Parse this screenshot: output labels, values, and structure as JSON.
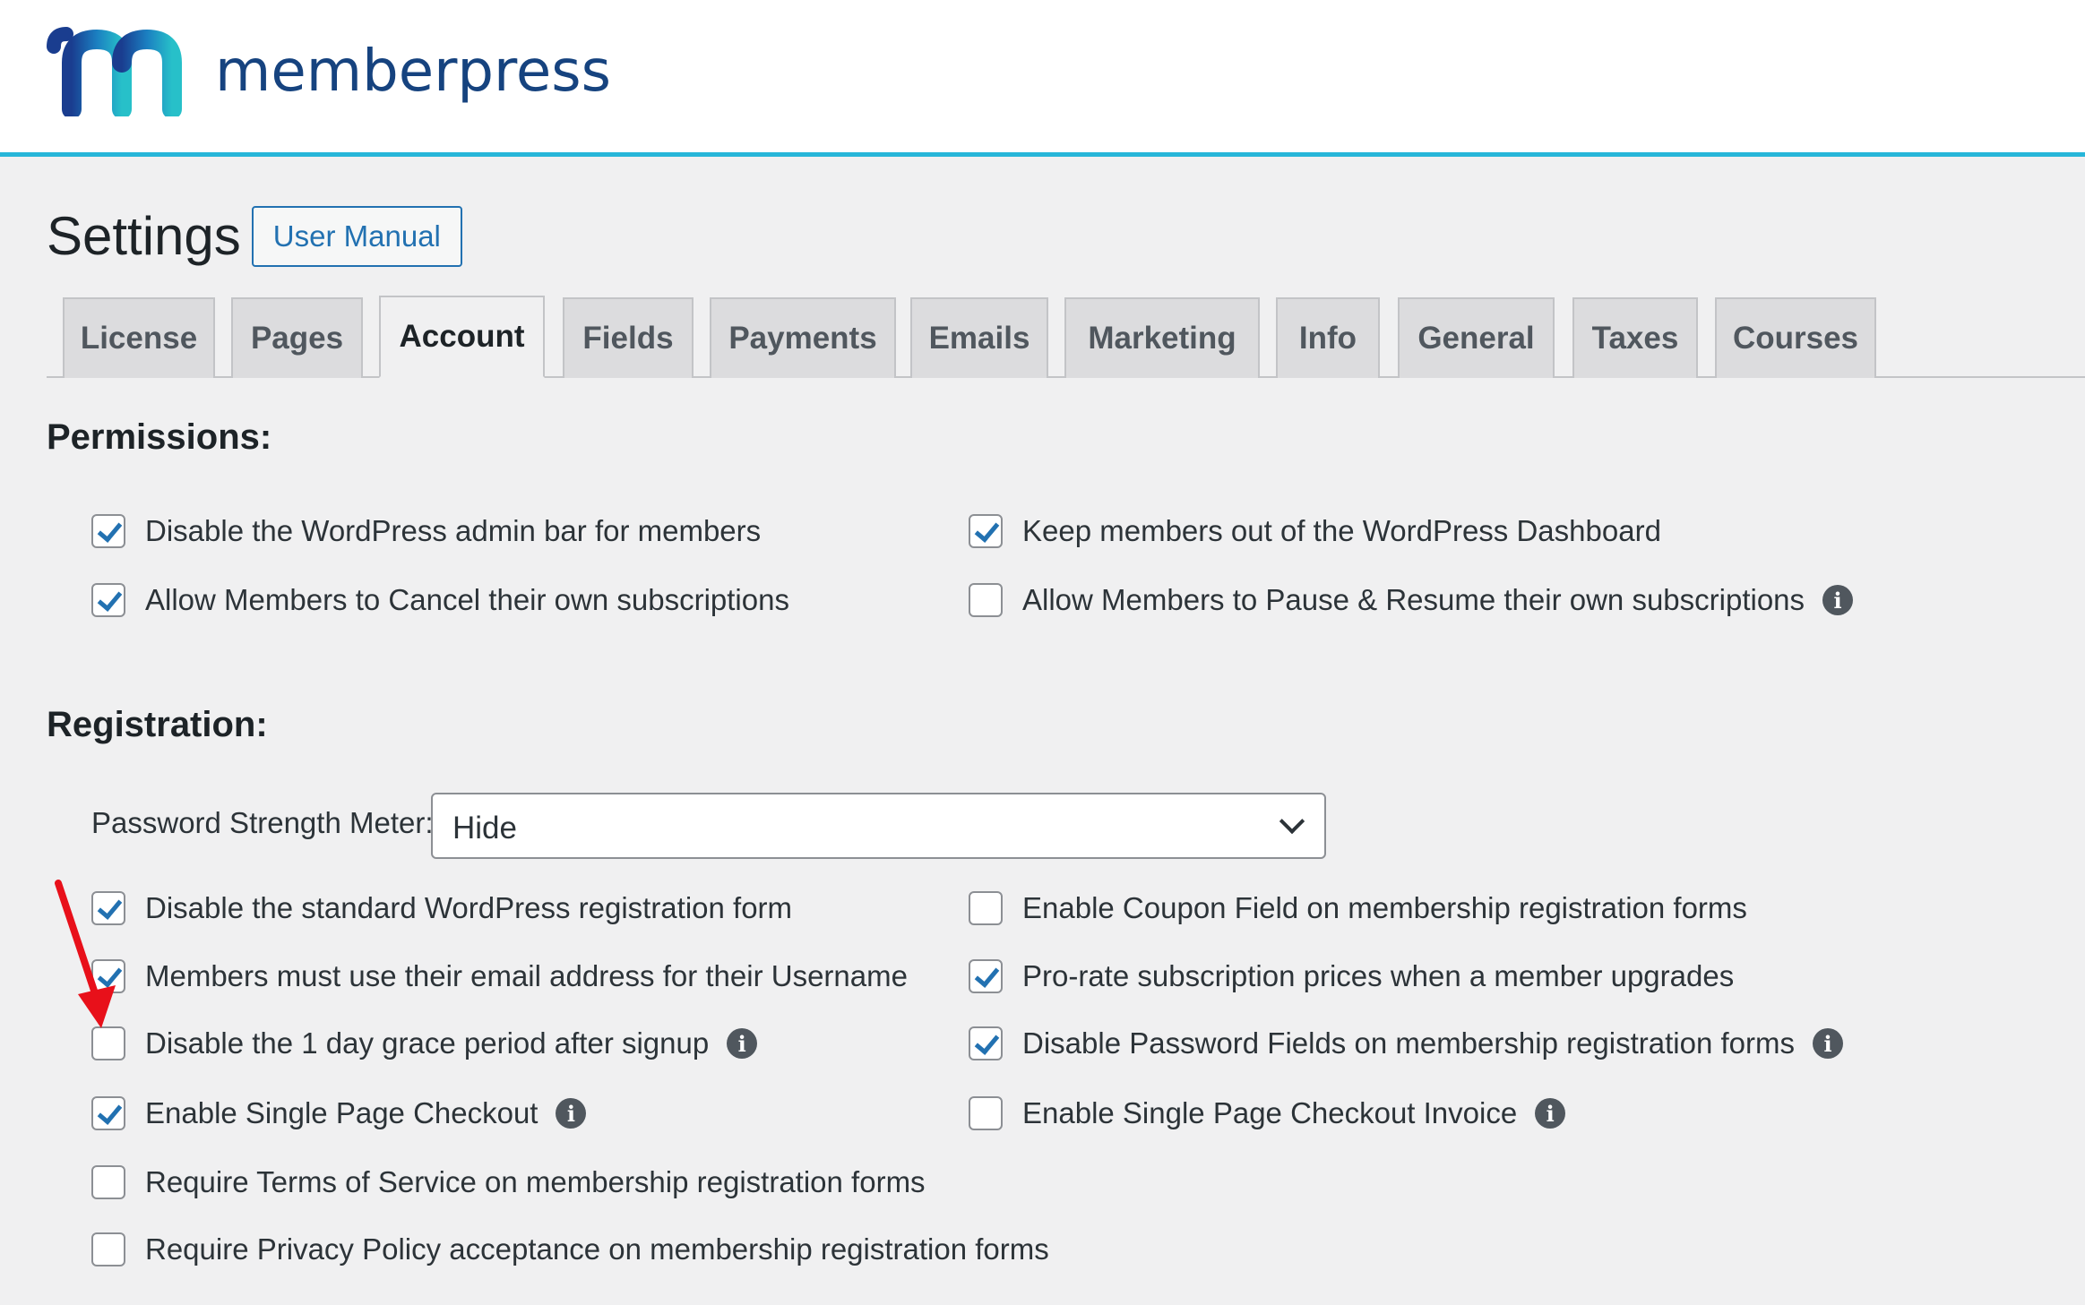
{
  "brand": {
    "name": "memberpress"
  },
  "page": {
    "title": "Settings",
    "manual_button": "User Manual"
  },
  "tabs": [
    {
      "label": "License",
      "active": false
    },
    {
      "label": "Pages",
      "active": false
    },
    {
      "label": "Account",
      "active": true
    },
    {
      "label": "Fields",
      "active": false
    },
    {
      "label": "Payments",
      "active": false
    },
    {
      "label": "Emails",
      "active": false
    },
    {
      "label": "Marketing",
      "active": false
    },
    {
      "label": "Info",
      "active": false
    },
    {
      "label": "General",
      "active": false
    },
    {
      "label": "Taxes",
      "active": false
    },
    {
      "label": "Courses",
      "active": false
    }
  ],
  "permissions": {
    "title": "Permissions:",
    "options": [
      {
        "label": "Disable the WordPress admin bar for members",
        "checked": true
      },
      {
        "label": "Keep members out of the WordPress Dashboard",
        "checked": true
      },
      {
        "label": "Allow Members to Cancel their own subscriptions",
        "checked": true
      },
      {
        "label": "Allow Members to Pause & Resume their own subscriptions",
        "checked": false
      }
    ]
  },
  "registration": {
    "title": "Registration:",
    "password_meter": {
      "label": "Password Strength Meter:",
      "value": "Hide"
    },
    "options": [
      {
        "label": "Disable the standard WordPress registration form",
        "checked": true
      },
      {
        "label": "Enable Coupon Field on membership registration forms",
        "checked": false
      },
      {
        "label": "Members must use their email address for their Username",
        "checked": true
      },
      {
        "label": "Pro-rate subscription prices when a member upgrades",
        "checked": true
      },
      {
        "label": "Disable the 1 day grace period after signup",
        "checked": false
      },
      {
        "label": "Disable Password Fields on membership registration forms",
        "checked": true
      },
      {
        "label": "Enable Single Page Checkout",
        "checked": true
      },
      {
        "label": "Enable Single Page Checkout Invoice",
        "checked": false
      },
      {
        "label": "Require Terms of Service on membership registration forms",
        "checked": false
      },
      {
        "label": "Require Privacy Policy acceptance on membership registration forms",
        "checked": false
      }
    ]
  },
  "icons": {
    "info": "i"
  },
  "colors": {
    "accent": "#2271b1",
    "header_border": "#27b6d9",
    "brand_text": "#16437f",
    "annotation_arrow": "#e8101a"
  }
}
